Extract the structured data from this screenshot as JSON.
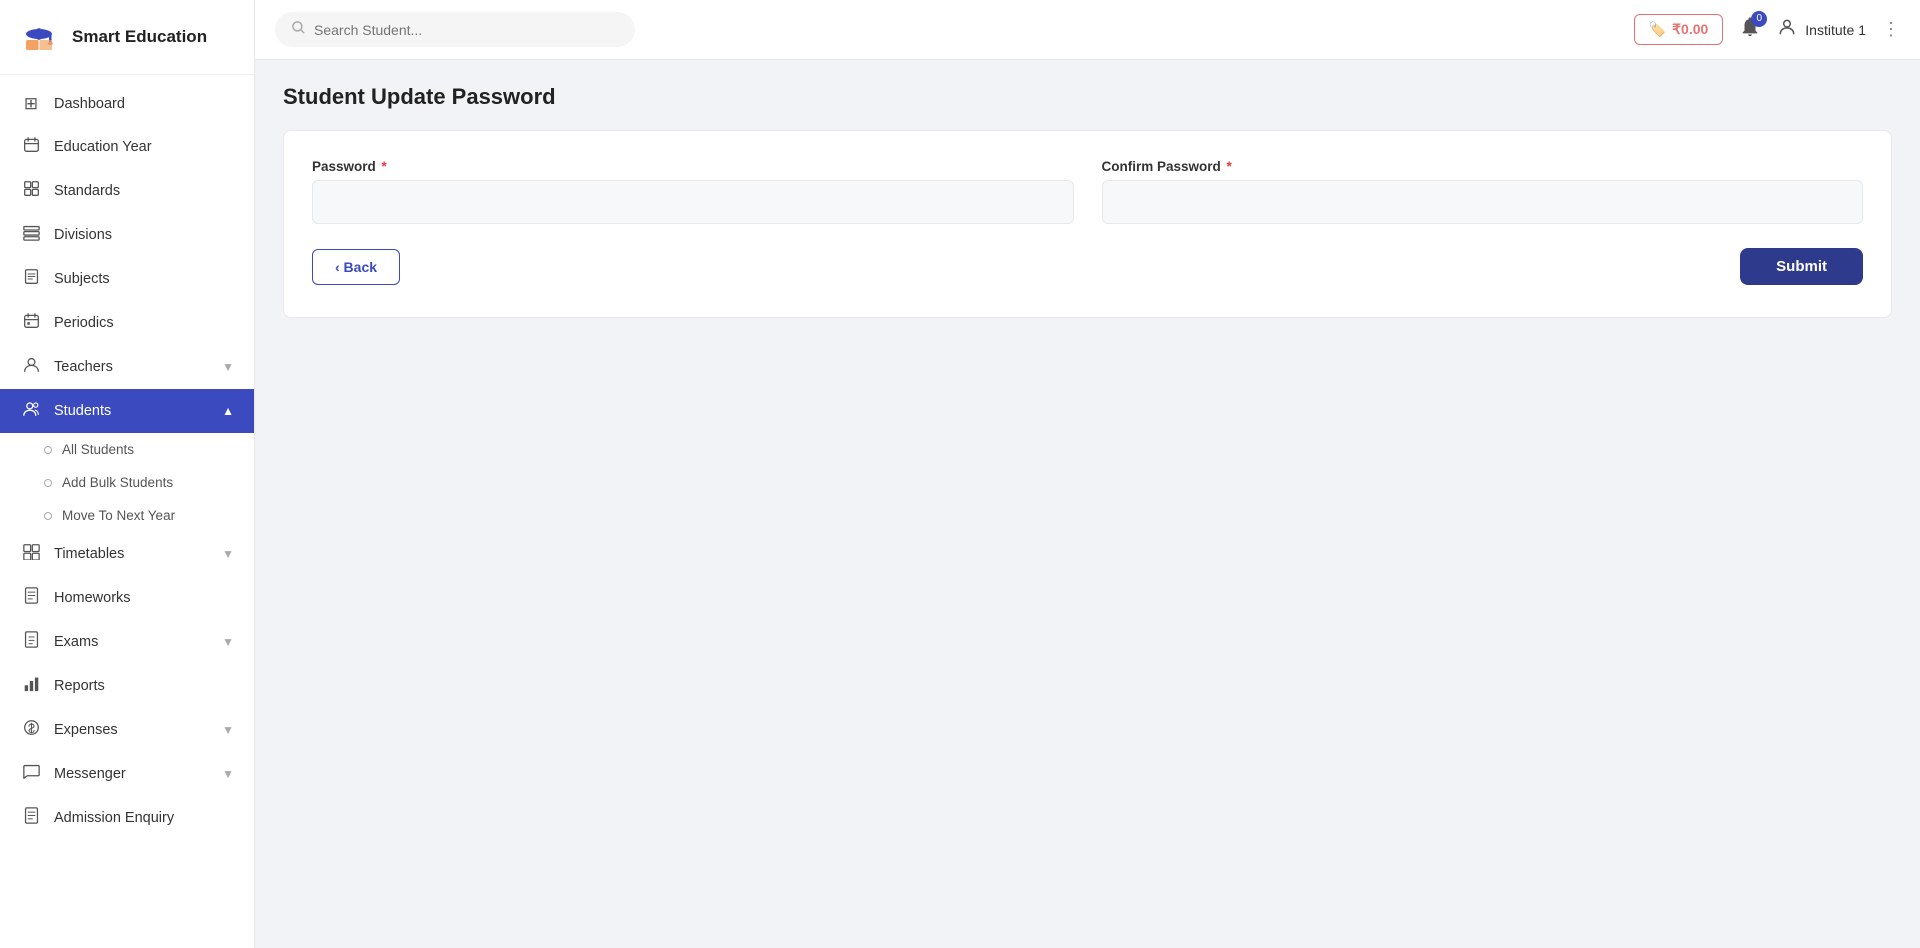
{
  "app": {
    "name": "Smart Education"
  },
  "topbar": {
    "search_placeholder": "Search Student...",
    "wallet_amount": "₹0.00",
    "notif_badge": "0",
    "user_name": "Institute 1"
  },
  "page": {
    "title": "Student Update Password"
  },
  "form": {
    "password_label": "Password",
    "confirm_password_label": "Confirm Password",
    "back_label": "‹ Back",
    "submit_label": "Submit"
  },
  "sidebar": {
    "logo_text": "Smart Education",
    "nav_items": [
      {
        "id": "dashboard",
        "label": "Dashboard",
        "icon": "⊞"
      },
      {
        "id": "education-year",
        "label": "Education Year",
        "icon": "📅"
      },
      {
        "id": "standards",
        "label": "Standards",
        "icon": "☰"
      },
      {
        "id": "divisions",
        "label": "Divisions",
        "icon": "⊟"
      },
      {
        "id": "subjects",
        "label": "Subjects",
        "icon": "📋"
      },
      {
        "id": "periodics",
        "label": "Periodics",
        "icon": "📆"
      },
      {
        "id": "teachers",
        "label": "Teachers",
        "icon": "👤",
        "has_chevron": true
      },
      {
        "id": "students",
        "label": "Students",
        "icon": "👥",
        "has_chevron": true,
        "active": true
      },
      {
        "id": "timetables",
        "label": "Timetables",
        "icon": "📊",
        "has_chevron": true
      },
      {
        "id": "homeworks",
        "label": "Homeworks",
        "icon": "📝"
      },
      {
        "id": "exams",
        "label": "Exams",
        "icon": "📋",
        "has_chevron": true
      },
      {
        "id": "reports",
        "label": "Reports",
        "icon": "📈"
      },
      {
        "id": "expenses",
        "label": "Expenses",
        "icon": "💰",
        "has_chevron": true
      },
      {
        "id": "messenger",
        "label": "Messenger",
        "icon": "💬",
        "has_chevron": true
      },
      {
        "id": "admission-enquiry",
        "label": "Admission Enquiry",
        "icon": "📋"
      }
    ],
    "students_sub_items": [
      {
        "id": "all-students",
        "label": "All Students"
      },
      {
        "id": "add-bulk-students",
        "label": "Add Bulk Students"
      },
      {
        "id": "move-to-next-year",
        "label": "Move To Next Year"
      }
    ]
  }
}
